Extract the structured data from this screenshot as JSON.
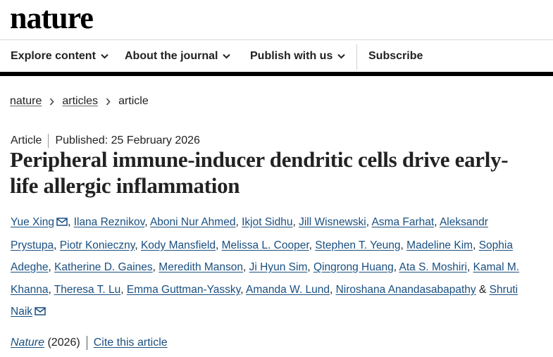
{
  "brand": {
    "logo": "nature"
  },
  "nav": {
    "explore": "Explore content",
    "about": "About the journal",
    "publish": "Publish with us",
    "subscribe": "Subscribe"
  },
  "breadcrumb": {
    "home": "nature",
    "section": "articles",
    "current": "article"
  },
  "meta": {
    "type": "Article",
    "published": "Published: 25 February 2026"
  },
  "title": {
    "line1": "Peripheral immune-inducer dendritic cells drive early-",
    "line2": "life allergic inflammation"
  },
  "authors": [
    "Yue Xing",
    "Ilana Reznikov",
    "Aboni Nur Ahmed",
    "Ikjot Sidhu",
    "Jill Wisnewski",
    "Asma Farhat",
    "Aleksandr",
    "Prystupa",
    "Piotr Konieczny",
    "Kody Mansfield",
    "Melissa L. Cooper",
    "Stephen T. Yeung",
    "Madeline Kim",
    "Sophia",
    "Adeghe",
    "Katherine D. Gaines",
    "Meredith Manson",
    "Ji Hyun Sim",
    "Qingrong Huang",
    "Ata S. Moshiri",
    "Kamal M.",
    "Khanna",
    "Theresa T. Lu",
    "Emma Guttman-Yassky",
    "Amanda W. Lund",
    "Niroshana Anandasabapathy",
    "Shruti",
    "Naik"
  ],
  "separators": {
    "comma": ", ",
    "and": " & "
  },
  "footer": {
    "journal": "Nature",
    "year": " (2026)",
    "cite": "Cite this article"
  },
  "icons": {
    "chevron": "chevron-down-icon",
    "mail": "mail-icon",
    "crumb": "chevron-right-icon"
  },
  "colors": {
    "link": "#1a4f80",
    "text": "#222222",
    "rule": "#000000"
  }
}
